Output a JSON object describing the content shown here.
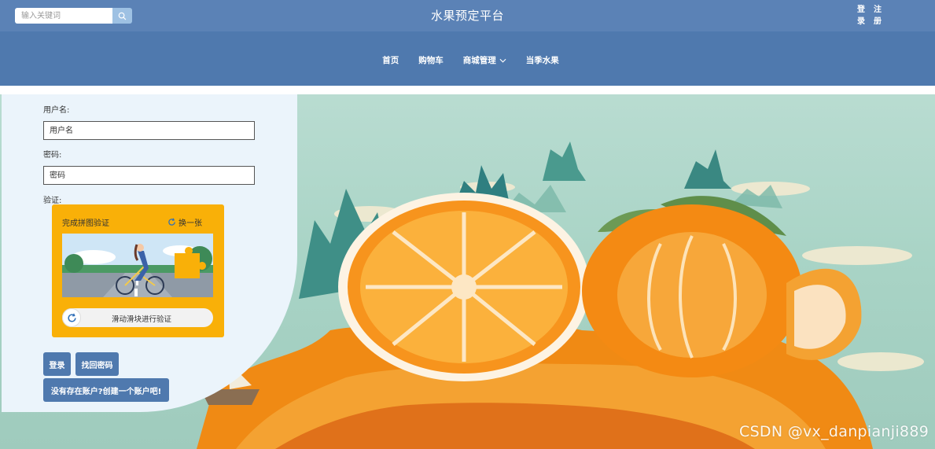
{
  "header": {
    "search": {
      "placeholder": "输入关键词",
      "value": ""
    },
    "title": "水果预定平台",
    "login_link": "登录",
    "register_link": "注册"
  },
  "nav": {
    "items": [
      {
        "label": "首页"
      },
      {
        "label": "购物车"
      },
      {
        "label": "商城管理",
        "has_dropdown": true
      },
      {
        "label": "当季水果"
      }
    ]
  },
  "login": {
    "username_label": "用户名:",
    "username_placeholder": "用户名",
    "password_label": "密码:",
    "password_placeholder": "密码",
    "verify_label": "验证:",
    "captcha": {
      "title": "完成拼图验证",
      "refresh_label": "换一张",
      "slider_text": "滑动滑块进行验证"
    },
    "login_button": "登录",
    "forgot_button": "找回密码",
    "register_button": "没有存在账户?创建一个账户吧!"
  },
  "watermark": "CSDN @vx_danpianji889",
  "colors": {
    "header_bg": "#5b82b6",
    "nav_bg": "#4f79ae",
    "panel_bg": "#ebf4fb",
    "captcha_bg": "#f9b008",
    "button_bg": "#4f79ae"
  }
}
